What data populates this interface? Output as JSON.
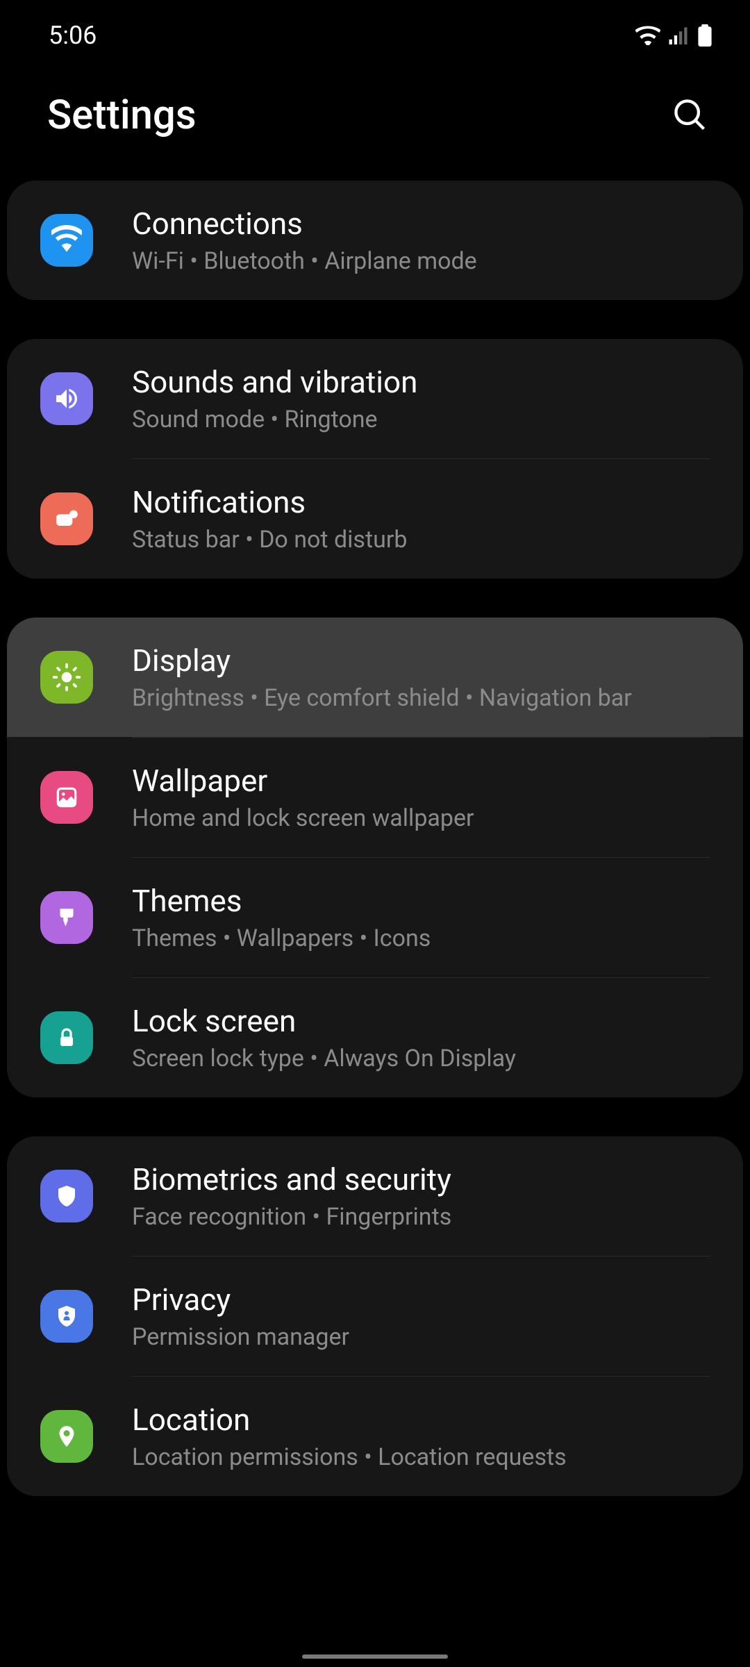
{
  "status": {
    "time": "5:06"
  },
  "header": {
    "title": "Settings"
  },
  "groups": [
    {
      "items": [
        {
          "id": "connections",
          "title": "Connections",
          "subtitle": "Wi-Fi  •  Bluetooth  •  Airplane mode",
          "icon_color": "#1f93f0",
          "highlighted": false
        }
      ]
    },
    {
      "items": [
        {
          "id": "sounds",
          "title": "Sounds and vibration",
          "subtitle": "Sound mode  •  Ringtone",
          "icon_color": "#7b73eb",
          "highlighted": false
        },
        {
          "id": "notifications",
          "title": "Notifications",
          "subtitle": "Status bar  •  Do not disturb",
          "icon_color": "#ed6b57",
          "highlighted": false
        }
      ]
    },
    {
      "items": [
        {
          "id": "display",
          "title": "Display",
          "subtitle": "Brightness  •  Eye comfort shield  •  Navigation bar",
          "icon_color": "#7eb828",
          "highlighted": true
        },
        {
          "id": "wallpaper",
          "title": "Wallpaper",
          "subtitle": "Home and lock screen wallpaper",
          "icon_color": "#e84b81",
          "highlighted": false
        },
        {
          "id": "themes",
          "title": "Themes",
          "subtitle": "Themes  •  Wallpapers  •  Icons",
          "icon_color": "#b067e0",
          "highlighted": false
        },
        {
          "id": "lockscreen",
          "title": "Lock screen",
          "subtitle": "Screen lock type  •  Always On Display",
          "icon_color": "#17a192",
          "highlighted": false
        }
      ]
    },
    {
      "items": [
        {
          "id": "biometrics",
          "title": "Biometrics and security",
          "subtitle": "Face recognition  •  Fingerprints",
          "icon_color": "#5f6ee8",
          "highlighted": false
        },
        {
          "id": "privacy",
          "title": "Privacy",
          "subtitle": "Permission manager",
          "icon_color": "#4977e6",
          "highlighted": false
        },
        {
          "id": "location",
          "title": "Location",
          "subtitle": "Location permissions  •  Location requests",
          "icon_color": "#61b63d",
          "highlighted": false
        }
      ]
    }
  ]
}
